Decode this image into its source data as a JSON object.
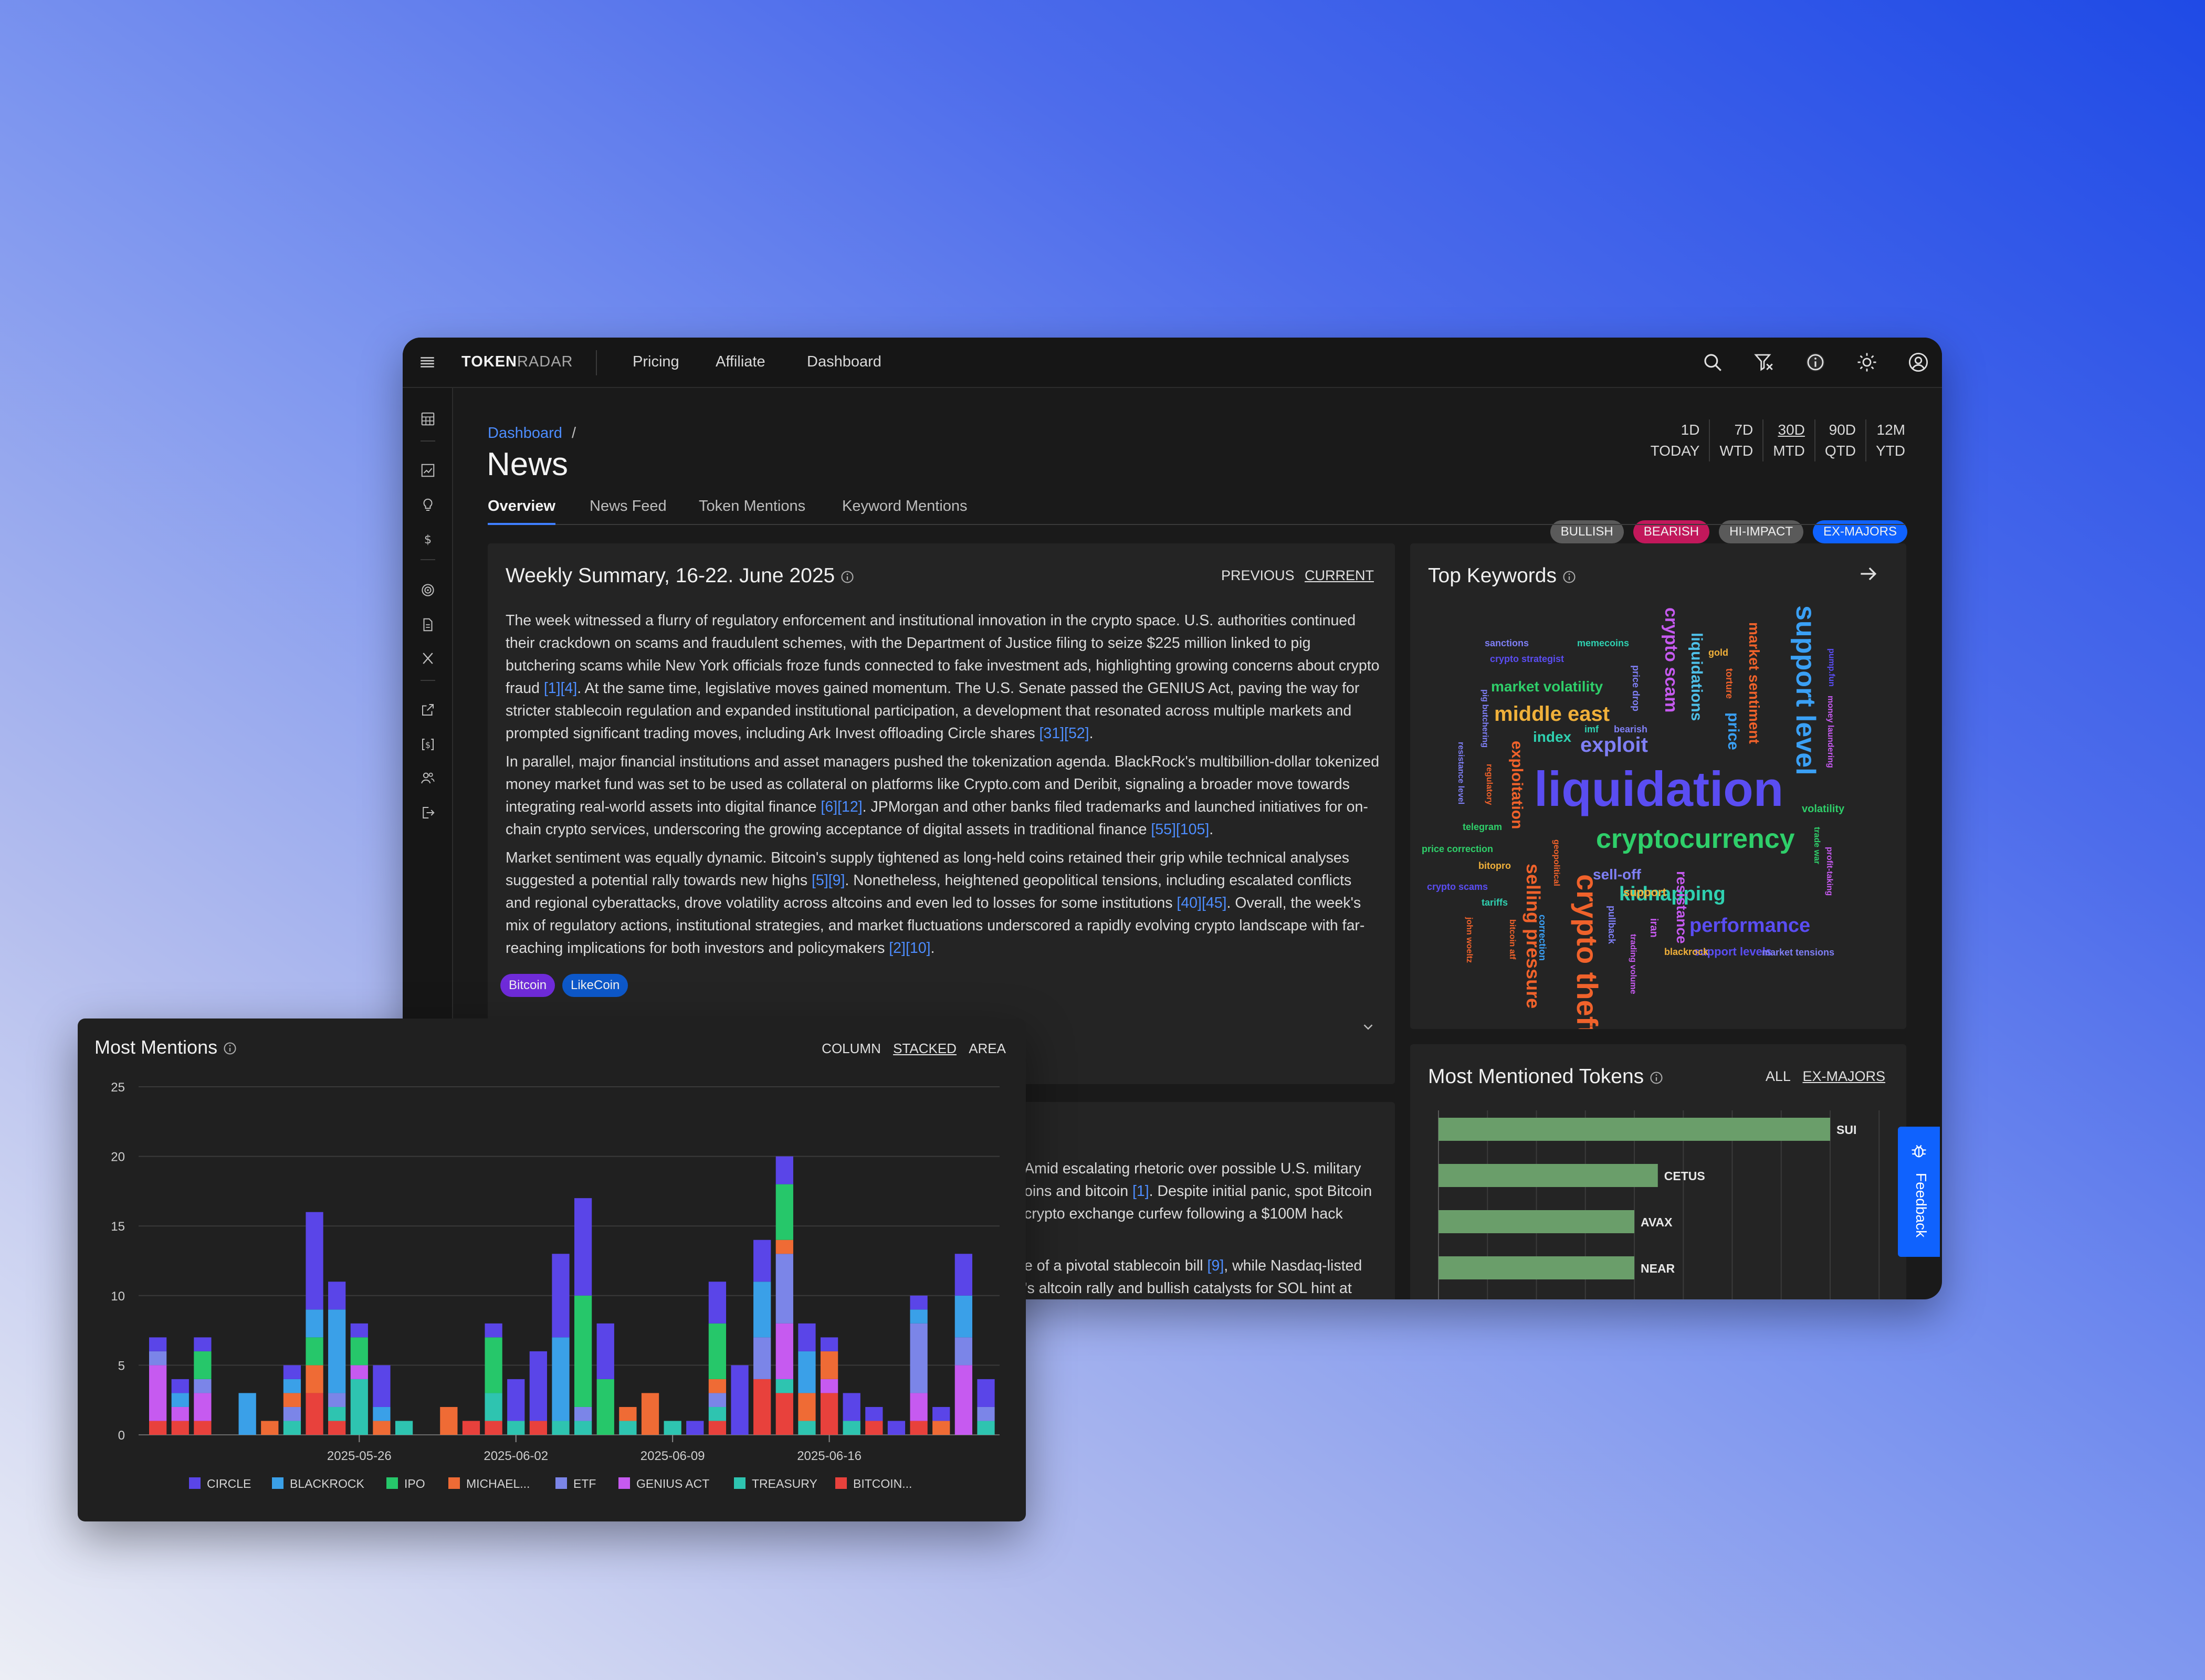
{
  "app": {
    "brand_bold": "TOKEN",
    "brand_light": "RADAR",
    "nav": [
      "Pricing",
      "Affiliate",
      "Dashboard"
    ]
  },
  "breadcrumb": {
    "root": "Dashboard",
    "sep": "/"
  },
  "page_title": "News",
  "tabs": [
    "Overview",
    "News Feed",
    "Token Mentions",
    "Keyword Mentions"
  ],
  "periods": [
    {
      "top": "1D",
      "bottom": "TODAY"
    },
    {
      "top": "7D",
      "bottom": "WTD"
    },
    {
      "top": "30D",
      "bottom": "MTD"
    },
    {
      "top": "90D",
      "bottom": "QTD"
    },
    {
      "top": "12M",
      "bottom": "YTD"
    }
  ],
  "filters": [
    {
      "label": "BULLISH",
      "color": "#5a5a5a"
    },
    {
      "label": "BEARISH",
      "color": "#c2185b"
    },
    {
      "label": "HI-IMPACT",
      "color": "#5a5a5a"
    },
    {
      "label": "EX-MAJORS",
      "color": "#0f62fe"
    }
  ],
  "summary": {
    "title": "Weekly Summary, 16-22. June 2025",
    "previous": "PREVIOUS",
    "current": "CURRENT",
    "p1": [
      "The week witnessed a flurry of regulatory enforcement and institutional innovation in the crypto space. U.S. authorities continued their crackdown on scams and fraudulent schemes, with the Department of Justice filing to seize $225 million linked to pig butchering scams while New York officials froze funds connected to fake investment ads, highlighting growing concerns about crypto fraud ",
      "[1][4]",
      ". At the same time, legislative moves gained momentum. The U.S. Senate passed the GENIUS Act, paving the way for stricter stablecoin regulation and expanded institutional participation, a development that resonated across multiple markets and prompted significant trading moves, including Ark Invest offloading Circle shares ",
      "[31][52]",
      "."
    ],
    "p2": [
      "In parallel, major financial institutions and asset managers pushed the tokenization agenda. BlackRock's multibillion-dollar tokenized money market fund was set to be used as collateral on platforms like Crypto.com and Deribit, signaling a broader move towards integrating real-world assets into digital finance ",
      "[6][12]",
      ". JPMorgan and other banks filed trademarks and launched initiatives for on-chain crypto services, underscoring the growing acceptance of digital assets in traditional finance ",
      "[55][105]",
      "."
    ],
    "p3": [
      "Market sentiment was equally dynamic. Bitcoin's supply tightened as long-held coins retained their grip while technical analyses suggested a potential rally towards new highs ",
      "[5][9]",
      ". Nonetheless, heightened geopolitical tensions, including escalated conflicts and regional cyberattacks, drove volatility across altcoins and even led to losses for some institutions ",
      "[40][45]",
      ". Overall, the week's mix of regulatory actions, institutional strategies, and market fluctuations underscored a rapidly evolving crypto landscape with far-reaching implications for both investors and policymakers ",
      "[2][10]",
      "."
    ],
    "tags": [
      {
        "label": "Bitcoin",
        "color": "#6f2bd9"
      },
      {
        "label": "LikeCoin",
        "color": "#0d58c9"
      }
    ]
  },
  "second_card": {
    "l1": [
      "Amid escalating rhetoric over possible U.S. military"
    ],
    "l2": [
      "oins and bitcoin ",
      "[1]",
      ". Despite initial panic, spot Bitcoin"
    ],
    "l3": [
      "crypto exchange curfew following a $100M hack"
    ],
    "l4": [
      "e of a pivotal stablecoin bill ",
      "[9]",
      ", while Nasdaq-listed"
    ],
    "l5": [
      "'s altcoin rally and bullish catalysts for SOL hint at"
    ]
  },
  "keywords": {
    "title": "Top Keywords",
    "words": [
      {
        "t": "liquidation",
        "c": "#5a4df2"
      },
      {
        "t": "cryptocurrency",
        "c": "#2fcf6a"
      },
      {
        "t": "crypto theft",
        "c": "#f0622b"
      },
      {
        "t": "selling pressure",
        "c": "#f0622b"
      },
      {
        "t": "support level",
        "c": "#3aa0f5"
      },
      {
        "t": "middle east",
        "c": "#f0b03a"
      },
      {
        "t": "kidnapping",
        "c": "#2fd0b0"
      },
      {
        "t": "crypto scam",
        "c": "#c65af0"
      },
      {
        "t": "liquidations",
        "c": "#4ec0e8"
      },
      {
        "t": "exploit",
        "c": "#7f7ff5"
      },
      {
        "t": "performance",
        "c": "#5a4df2"
      },
      {
        "t": "market sentiment",
        "c": "#f0622b"
      },
      {
        "t": "market volatility",
        "c": "#2fcf6a"
      },
      {
        "t": "price",
        "c": "#3aa0f5"
      },
      {
        "t": "exploitation",
        "c": "#f0622b"
      },
      {
        "t": "resistance",
        "c": "#c65af0"
      },
      {
        "t": "sell-off",
        "c": "#7f7ff5"
      },
      {
        "t": "index",
        "c": "#2fd0b0"
      },
      {
        "t": "support levels",
        "c": "#5a4df2"
      },
      {
        "t": "volatility",
        "c": "#2fcf6a"
      },
      {
        "t": "sanctions",
        "c": "#7f7ff5"
      },
      {
        "t": "memecoins",
        "c": "#2fd0b0"
      },
      {
        "t": "crypto strategist",
        "c": "#5a4df2"
      },
      {
        "t": "gold",
        "c": "#f0b03a"
      },
      {
        "t": "torture",
        "c": "#f0622b"
      },
      {
        "t": "pump.fun",
        "c": "#5a4df2"
      },
      {
        "t": "money laundering",
        "c": "#c65af0"
      },
      {
        "t": "pig butchering",
        "c": "#7f7ff5"
      },
      {
        "t": "price drop",
        "c": "#7f7ff5"
      },
      {
        "t": "imf",
        "c": "#2fd0b0"
      },
      {
        "t": "bearish",
        "c": "#7f7ff5"
      },
      {
        "t": "resistance level",
        "c": "#7f7ff5"
      },
      {
        "t": "regulatory",
        "c": "#f0622b"
      },
      {
        "t": "telegram",
        "c": "#2fcf6a"
      },
      {
        "t": "price correction",
        "c": "#2fcf6a"
      },
      {
        "t": "geopolitical",
        "c": "#f0622b"
      },
      {
        "t": "trade war",
        "c": "#2fcf6a"
      },
      {
        "t": "profit-taking",
        "c": "#c65af0"
      },
      {
        "t": "bitopro",
        "c": "#f0b03a"
      },
      {
        "t": "crypto scams",
        "c": "#5a4df2"
      },
      {
        "t": "tariffs",
        "c": "#2fd0b0"
      },
      {
        "t": "support",
        "c": "#f0b03a"
      },
      {
        "t": "iran",
        "c": "#c65af0"
      },
      {
        "t": "pullback",
        "c": "#7f7ff5"
      },
      {
        "t": "correction",
        "c": "#3aa0f5"
      },
      {
        "t": "bitcoin atf",
        "c": "#f0622b"
      },
      {
        "t": "john woeltz",
        "c": "#f0622b"
      },
      {
        "t": "trading volume",
        "c": "#c65af0"
      },
      {
        "t": "blackrock",
        "c": "#f0b03a"
      },
      {
        "t": "market tensions",
        "c": "#7f7ff5"
      }
    ]
  },
  "tokens": {
    "title": "Most Mentioned Tokens",
    "all": "ALL",
    "exmajors": "EX-MAJORS",
    "bar_color": "#6a9e6a",
    "items": [
      {
        "name": "SUI",
        "value": 1.0
      },
      {
        "name": "CETUS",
        "value": 0.56
      },
      {
        "name": "AVAX",
        "value": 0.5
      },
      {
        "name": "NEAR",
        "value": 0.5
      }
    ]
  },
  "mentions": {
    "title": "Most Mentions",
    "modes": [
      "COLUMN",
      "STACKED",
      "AREA"
    ]
  },
  "feedback": {
    "label": "Feedback"
  },
  "chart_data": {
    "type": "bar",
    "stacked": true,
    "title": "Most Mentions",
    "ylim": [
      0,
      25
    ],
    "yticks": [
      0,
      5,
      10,
      15,
      20,
      25
    ],
    "grid": true,
    "legend_position": "bottom",
    "xtick_labels": [
      {
        "index": 9,
        "label": "2025-05-26"
      },
      {
        "index": 16,
        "label": "2025-06-02"
      },
      {
        "index": 23,
        "label": "2025-06-09"
      },
      {
        "index": 30,
        "label": "2025-06-16"
      }
    ],
    "series": [
      {
        "name": "BITCOIN...",
        "color": "#e8413c",
        "values": [
          1,
          1,
          1,
          0,
          0,
          0,
          0,
          3,
          1,
          0,
          0,
          0,
          0,
          0,
          1,
          1,
          0,
          1,
          0,
          0,
          0,
          0,
          0,
          0,
          0,
          1,
          0,
          4,
          3,
          0,
          3,
          0,
          1,
          0,
          1,
          0,
          0,
          0
        ]
      },
      {
        "name": "TREASURY",
        "color": "#2ec4b0",
        "values": [
          0,
          0,
          0,
          0,
          0,
          0,
          1,
          0,
          1,
          4,
          0,
          1,
          0,
          0,
          0,
          2,
          1,
          0,
          1,
          1,
          0,
          1,
          0,
          1,
          0,
          1,
          0,
          0,
          1,
          1,
          0,
          1,
          0,
          0,
          0,
          0,
          0,
          1
        ]
      },
      {
        "name": "GENIUS ACT",
        "color": "#c65af0",
        "values": [
          4,
          1,
          2,
          0,
          0,
          0,
          0,
          0,
          0,
          1,
          0,
          0,
          0,
          0,
          0,
          0,
          0,
          0,
          0,
          0,
          0,
          0,
          0,
          0,
          0,
          0,
          0,
          0,
          4,
          0,
          1,
          0,
          0,
          0,
          2,
          0,
          5,
          0
        ]
      },
      {
        "name": "ETF",
        "color": "#7b85e8",
        "values": [
          1,
          0,
          1,
          0,
          0,
          0,
          1,
          0,
          1,
          0,
          0,
          0,
          0,
          0,
          0,
          0,
          0,
          0,
          0,
          1,
          0,
          0,
          0,
          0,
          0,
          1,
          0,
          3,
          5,
          0,
          0,
          0,
          0,
          0,
          5,
          0,
          2,
          1
        ]
      },
      {
        "name": "MICHAEL...",
        "color": "#ef6b35",
        "values": [
          0,
          0,
          0,
          0,
          0,
          1,
          1,
          2,
          0,
          0,
          1,
          0,
          0,
          2,
          0,
          0,
          0,
          0,
          0,
          0,
          0,
          1,
          3,
          0,
          0,
          1,
          0,
          0,
          1,
          2,
          2,
          0,
          0,
          0,
          0,
          1,
          0,
          0
        ]
      },
      {
        "name": "IPO",
        "color": "#26c76a",
        "values": [
          0,
          0,
          2,
          0,
          0,
          0,
          0,
          2,
          0,
          2,
          0,
          0,
          0,
          0,
          0,
          4,
          0,
          0,
          0,
          8,
          4,
          0,
          0,
          0,
          0,
          4,
          0,
          0,
          4,
          0,
          0,
          0,
          0,
          0,
          0,
          0,
          0,
          0
        ]
      },
      {
        "name": "BLACKROCK",
        "color": "#3aa0e8",
        "values": [
          0,
          1,
          0,
          0,
          3,
          0,
          1,
          2,
          6,
          0,
          1,
          0,
          0,
          0,
          0,
          0,
          0,
          0,
          6,
          0,
          0,
          0,
          0,
          0,
          0,
          0,
          0,
          4,
          0,
          3,
          0,
          0,
          0,
          0,
          1,
          0,
          3,
          0
        ]
      },
      {
        "name": "CIRCLE",
        "color": "#5a45e8",
        "values": [
          1,
          1,
          1,
          0,
          0,
          0,
          1,
          7,
          2,
          1,
          3,
          0,
          0,
          0,
          0,
          1,
          3,
          5,
          6,
          7,
          4,
          0,
          0,
          0,
          1,
          3,
          5,
          3,
          2,
          2,
          1,
          2,
          1,
          1,
          1,
          1,
          3,
          2
        ]
      }
    ]
  }
}
